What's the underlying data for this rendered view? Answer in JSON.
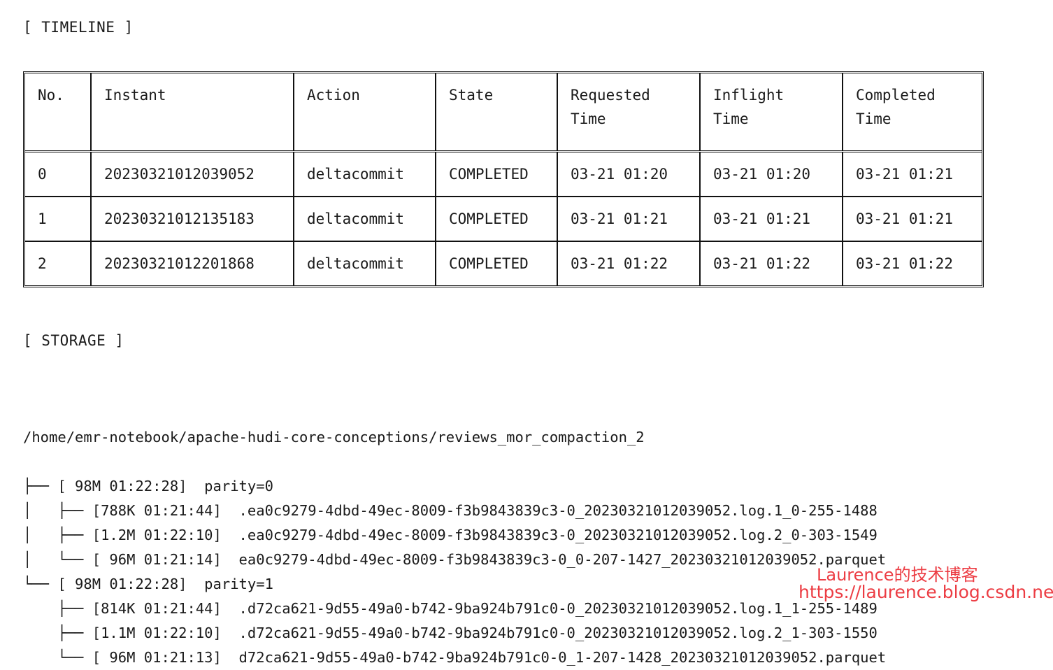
{
  "sections": {
    "timeline_label": "[ TIMELINE ]",
    "storage_label": "[ STORAGE ]"
  },
  "timeline_table": {
    "headers": {
      "no": "No.",
      "instant": "Instant",
      "action": "Action",
      "state": "State",
      "requested_time": "Requested\nTime",
      "inflight_time": "Inflight\nTime",
      "completed_time": "Completed\nTime"
    },
    "rows": [
      {
        "no": "0",
        "instant": "20230321012039052",
        "action": "deltacommit",
        "state": "COMPLETED",
        "requested_time": "03-21 01:20",
        "inflight_time": "03-21 01:20",
        "completed_time": "03-21 01:21"
      },
      {
        "no": "1",
        "instant": "20230321012135183",
        "action": "deltacommit",
        "state": "COMPLETED",
        "requested_time": "03-21 01:21",
        "inflight_time": "03-21 01:21",
        "completed_time": "03-21 01:21"
      },
      {
        "no": "2",
        "instant": "20230321012201868",
        "action": "deltacommit",
        "state": "COMPLETED",
        "requested_time": "03-21 01:22",
        "inflight_time": "03-21 01:22",
        "completed_time": "03-21 01:22"
      }
    ]
  },
  "storage_tree": {
    "root_path": "/home/emr-notebook/apache-hudi-core-conceptions/reviews_mor_compaction_2",
    "lines": [
      "├── [ 98M 01:22:28]  parity=0",
      "│   ├── [788K 01:21:44]  .ea0c9279-4dbd-49ec-8009-f3b9843839c3-0_20230321012039052.log.1_0-255-1488",
      "│   ├── [1.2M 01:22:10]  .ea0c9279-4dbd-49ec-8009-f3b9843839c3-0_20230321012039052.log.2_0-303-1549",
      "│   └── [ 96M 01:21:14]  ea0c9279-4dbd-49ec-8009-f3b9843839c3-0_0-207-1427_20230321012039052.parquet",
      "└── [ 98M 01:22:28]  parity=1",
      "    ├── [814K 01:21:44]  .d72ca621-9d55-49a0-b742-9ba924b791c0-0_20230321012039052.log.1_1-255-1489",
      "    ├── [1.1M 01:22:10]  .d72ca621-9d55-49a0-b742-9ba924b791c0-0_20230321012039052.log.2_1-303-1550",
      "    └── [ 96M 01:21:13]  d72ca621-9d55-49a0-b742-9ba924b791c0-0_1-207-1428_20230321012039052.parquet"
    ]
  },
  "watermark": {
    "chinese": "Laurence的技术博客",
    "url": "https://laurence.blog.csdn.net",
    "color": "#e8121a"
  }
}
